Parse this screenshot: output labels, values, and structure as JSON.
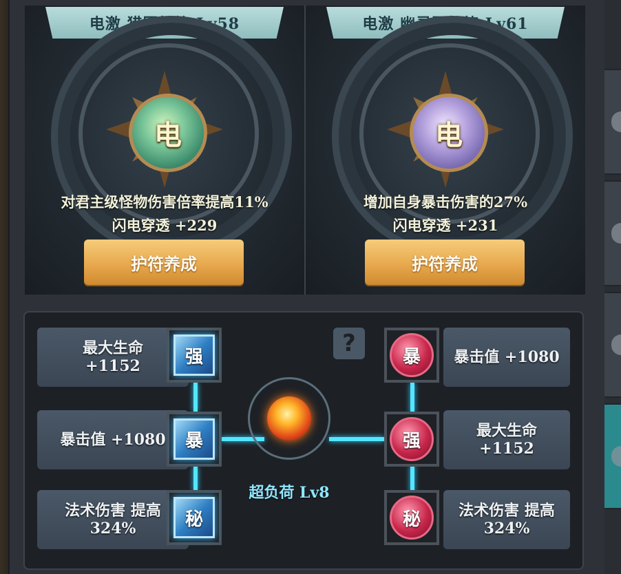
{
  "amulets": [
    {
      "title": "电激 猎团护符 Lv58",
      "orb_char": "电",
      "effect": "对君主级怪物伤害倍率提高11%",
      "stat": "闪电穿透 +229",
      "button": "护符养成"
    },
    {
      "title": "电激 幽灵团护符 Lv61",
      "orb_char": "电",
      "effect": "增加自身暴击伤害的27%",
      "stat": "闪电穿透 +231",
      "button": "护符养成"
    }
  ],
  "overload": {
    "help": "?",
    "core_label": "超负荷 Lv8",
    "left_slots": [
      {
        "stat": "最大生命 +1152",
        "gem": "强"
      },
      {
        "stat": "暴击值 +1080",
        "gem": "暴"
      },
      {
        "stat": "法术伤害 提高 324%",
        "gem": "秘"
      }
    ],
    "right_slots": [
      {
        "gem": "暴",
        "stat": "暴击值 +1080"
      },
      {
        "gem": "强",
        "stat": "最大生命 +1152"
      },
      {
        "gem": "秘",
        "stat": "法术伤害 提高 324%"
      }
    ]
  },
  "colors": {
    "accent_cyan": "#54e6ff",
    "button_gold": "#e6a54a",
    "gem_blue": "#2f7fc3",
    "gem_red": "#c8264b"
  }
}
